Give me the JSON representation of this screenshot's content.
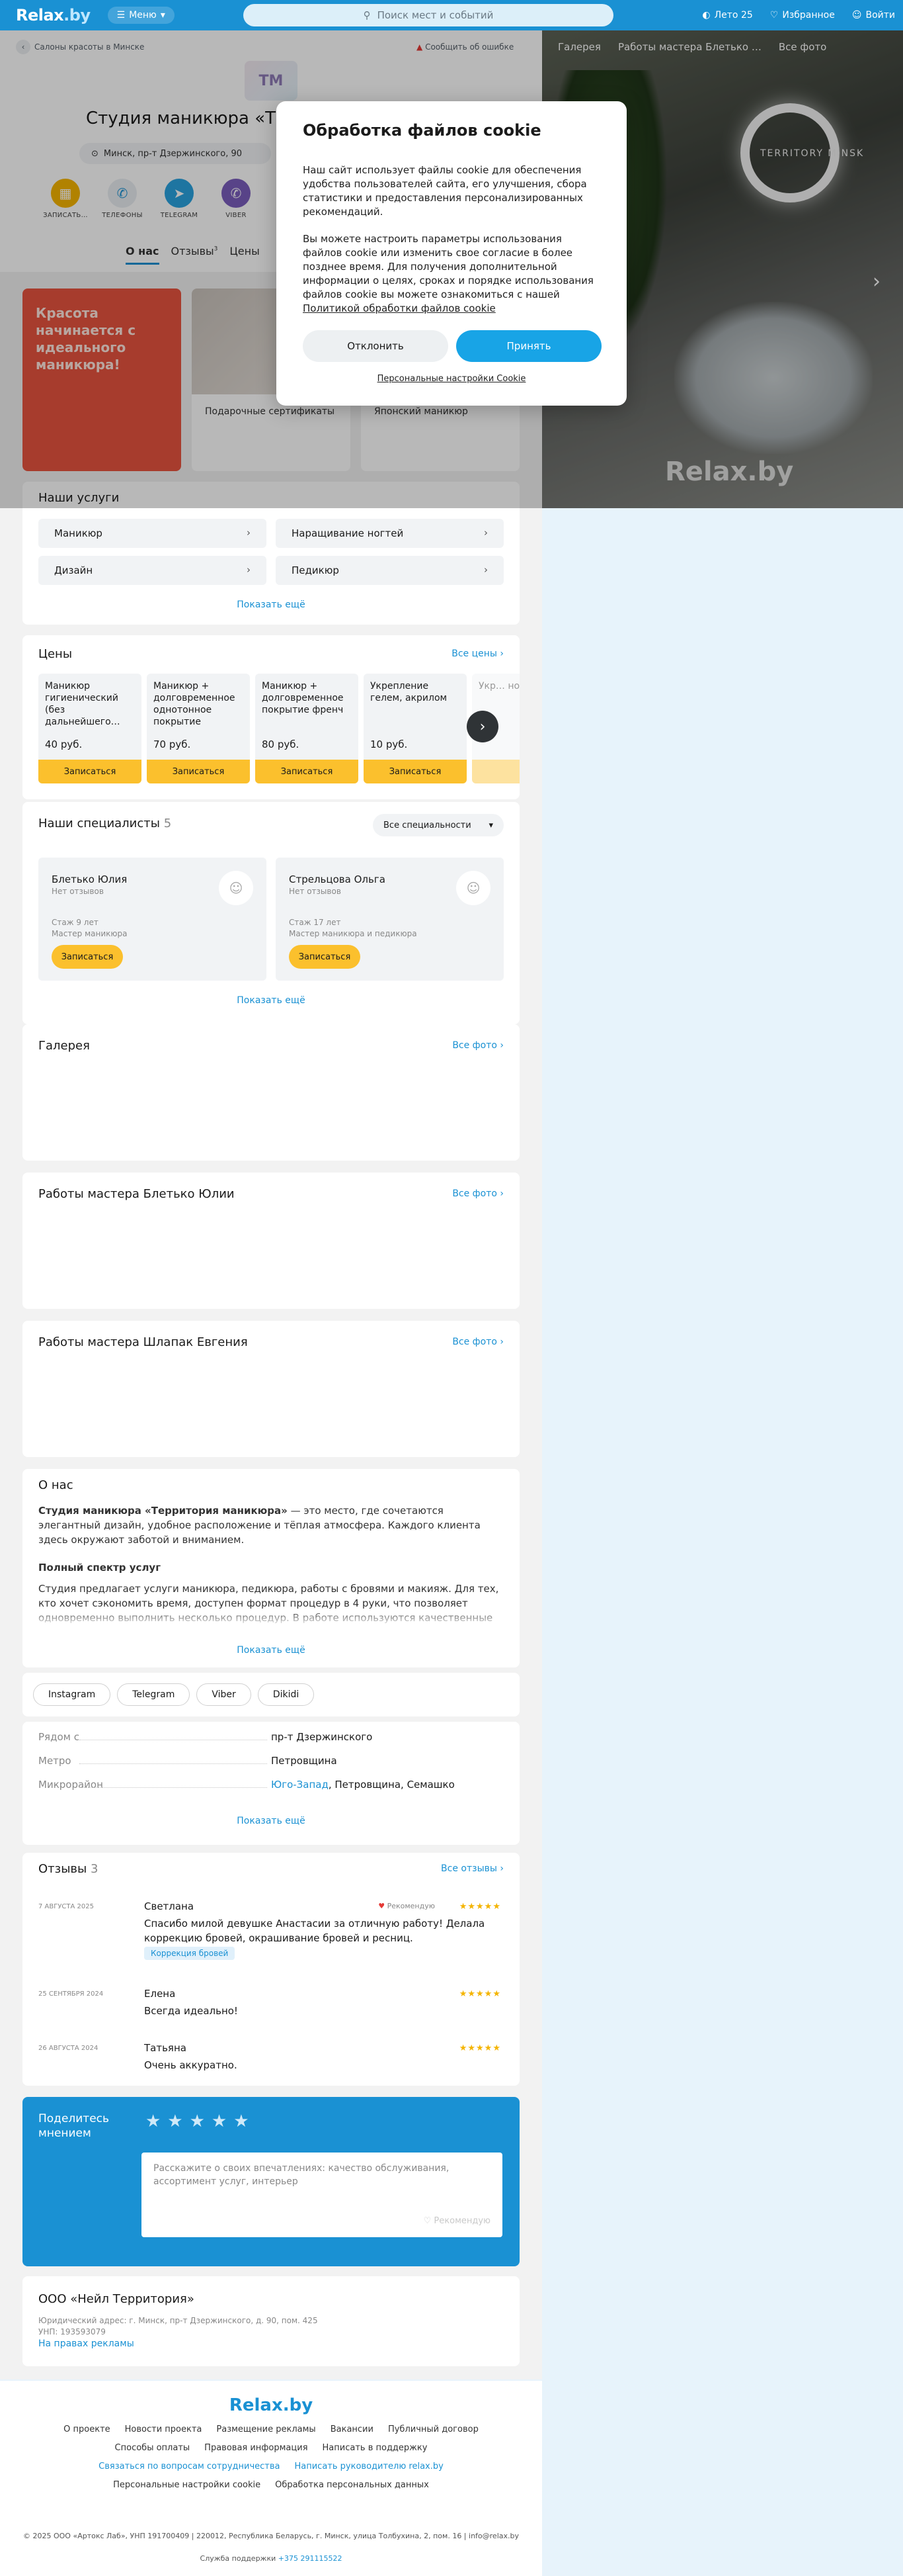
{
  "topbar": {
    "logo": "Relax",
    "logo_suffix": ".by",
    "menu_label": "Меню",
    "search_placeholder": "Поиск мест и событий",
    "summer_label": "Лето 25",
    "favorites_label": "Избранное",
    "login_label": "Войти"
  },
  "breadcrumb": "Салоны красоты в Минске",
  "report_error": "Сообщить об ошибке",
  "salon": {
    "logo_text": "TM",
    "title": "Студия маникюра «Территория маникюра»",
    "address": "Минск, пр-т Дзержинского, 90"
  },
  "actions": [
    {
      "label": "ЗАПИСАТЬ…",
      "icon": "calendar-icon",
      "color": "#f5b400"
    },
    {
      "label": "ТЕЛЕФОНЫ",
      "icon": "phone-icon",
      "color": "#e9eef2"
    },
    {
      "label": "TELEGRAM",
      "icon": "telegram-icon",
      "color": "#2aa3df"
    },
    {
      "label": "VIBER",
      "icon": "viber-icon",
      "color": "#7b5dbd"
    }
  ],
  "tabs": [
    {
      "label": "О нас"
    },
    {
      "label": "Отзывы",
      "count": "3"
    },
    {
      "label": "Цены"
    }
  ],
  "gallery": {
    "nav": [
      "Галерея",
      "Работы мастера Блетько …",
      "Все фото"
    ],
    "sign": "TERRITORY MINSK",
    "watermark": "Relax.by"
  },
  "promos": [
    {
      "text": "Красота начинается с идеального маникюра!"
    },
    {
      "label": "Подарочные сертификаты"
    },
    {
      "label": "Японский маникюр"
    }
  ],
  "services": {
    "title": "Наши услуги",
    "items": [
      "Маникюр",
      "Наращивание ногтей",
      "Дизайн",
      "Педикюр"
    ],
    "show_more": "Показать ещё"
  },
  "prices": {
    "title": "Цены",
    "all_link": "Все цены",
    "items": [
      {
        "name": "Маникюр гигиенический (без дальнейшего…",
        "price": "40 руб.",
        "button": "Записаться"
      },
      {
        "name": "Маникюр + долговременное однотонное покрытие",
        "price": "70 руб.",
        "button": "Записаться"
      },
      {
        "name": "Маникюр + долговременное покрытие френч",
        "price": "80 руб.",
        "button": "Записаться"
      },
      {
        "name": "Укрепление гелем, акрилом",
        "price": "10 руб.",
        "button": "Записаться"
      },
      {
        "name": "Укр… ног…",
        "price": "",
        "button": ""
      }
    ]
  },
  "specialists": {
    "title": "Наши специалисты",
    "count": "5",
    "filter": "Все специальности",
    "items": [
      {
        "name": "Блетько Юлия",
        "reviews": "Нет отзывов",
        "experience": "Стаж 9 лет",
        "role": "Мастер маникюра",
        "button": "Записаться"
      },
      {
        "name": "Стрельцова Ольга",
        "reviews": "Нет отзывов",
        "experience": "Стаж 17 лет",
        "role": "Мастер маникюра и педикюра",
        "button": "Записаться"
      }
    ],
    "show_more": "Показать ещё"
  },
  "gallery_sections": [
    {
      "title": "Галерея",
      "all_link": "Все фото"
    },
    {
      "title": "Работы мастера Блетько Юлии",
      "all_link": "Все фото"
    },
    {
      "title": "Работы мастера Шлапак Евгения",
      "all_link": "Все фото"
    }
  ],
  "about": {
    "title": "О нас",
    "p1_bold": "Студия маникюра «Территория маникюра»",
    "p1_rest": " — это место, где сочетаются элегантный дизайн, удобное расположение и тёплая атмосфера. Каждого клиента здесь окружают заботой и вниманием.",
    "h2": "Полный спектр услуг",
    "p2": "Студия предлагает услуги маникюра, педикюра, работы с бровями и макияж. Для тех, кто хочет сэкономить время, доступен формат процедур в 4 руки, что позволяет одновременно выполнить несколько процедур. В работе используются качественные",
    "show_more": "Показать ещё"
  },
  "socials": [
    "Instagram",
    "Telegram",
    "Viber",
    "Dikidi"
  ],
  "location": {
    "rows": [
      {
        "key": "Рядом с",
        "value": "пр-т Дзержинского"
      },
      {
        "key": "Метро",
        "value": "Петровщина"
      },
      {
        "key": "Микрорайон",
        "value_link": "Юго-Запад",
        "value": ", Петровщина, Семашко"
      }
    ],
    "show_more": "Показать ещё"
  },
  "reviews": {
    "title": "Отзывы",
    "count": "3",
    "all_link": "Все отзывы",
    "items": [
      {
        "date": "7 АВГУСТА 2025",
        "name": "Светлана",
        "text": "Спасибо милой девушке Анастасии за отличную работу! Делала коррекцию бровей, окрашивание бровей и ресниц.",
        "recommend": "Рекомендую",
        "tag": "Коррекция бровей",
        "stars": "★★★★★"
      },
      {
        "date": "25 СЕНТЯБРЯ 2024",
        "name": "Елена",
        "text": "Всегда идеально!",
        "stars": "★★★★★"
      },
      {
        "date": "26 АВГУСТА 2024",
        "name": "Татьяна",
        "text": "Очень аккуратно.",
        "stars": "★★★★★"
      }
    ]
  },
  "share": {
    "title": "Поделитесь мнением",
    "stars": "★★★★★",
    "placeholder": "Расскажите о своих впечатлениях: качество обслуживания, ассортимент услуг, интерьер",
    "recommend": "Рекомендую"
  },
  "legal": {
    "company": "ООО «Нейл Территория»",
    "address": "Юридический адрес: г. Минск, пр-т Дзержинского, д. 90, пом. 425",
    "unp": "УНП: 193593079",
    "ad_link": "На правах рекламы"
  },
  "footer": {
    "logo": "Relax.by",
    "row1": [
      "О проекте",
      "Новости проекта",
      "Размещение рекламы",
      "Вакансии",
      "Публичный договор"
    ],
    "row2": [
      "Способы оплаты",
      "Правовая информация",
      "Написать в поддержку"
    ],
    "row3": [
      "Связаться по вопросам сотрудничества",
      "Написать руководителю relax.by"
    ],
    "row4": [
      "Персональные настройки cookie",
      "Обработка персональных данных"
    ],
    "copyright": "© 2025 ООО «Артокс Лаб», УНП 191700409 | 220012, Республика Беларусь, г. Минск, улица Толбухина, 2, пом. 16 | info@relax.by",
    "support_label": "Служба поддержки",
    "support_phone": "+375 291115522"
  },
  "cookie_modal": {
    "title": "Обработка файлов cookie",
    "p1": "Наш сайт использует файлы cookie для обеспечения удобства пользователей сайта, его улучшения, сбора статистики и предоставления персонализированных рекомендаций.",
    "p2": "Вы можете настроить параметры использования файлов cookie или изменить свое согласие в более позднее время. Для получения дополнительной информации о целях, сроках и порядке использования файлов cookie вы можете ознакомиться с нашей",
    "policy_link": "Политикой обработки файлов cookie",
    "decline": "Отклонить",
    "accept": "Принять",
    "settings_link": "Персональные настройки Cookie"
  }
}
